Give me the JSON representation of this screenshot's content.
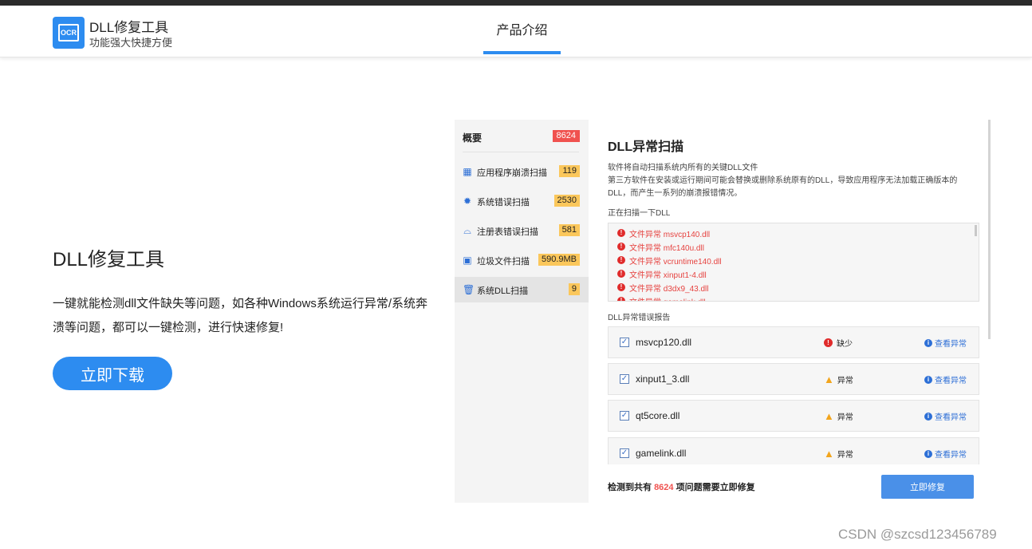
{
  "header": {
    "logo_text": "OCR",
    "brand_title": "DLL修复工具",
    "brand_subtitle": "功能强大快捷方便",
    "nav_tab": "产品介绍"
  },
  "hero": {
    "title": "DLL修复工具",
    "description": "一键就能检测dll文件缺失等问题，如各种Windows系统运行异常/系统奔溃等问题，都可以一键检测，进行快速修复!",
    "download_label": "立即下载"
  },
  "app": {
    "sidebar": {
      "overview_label": "概要",
      "overview_count": "8624",
      "items": [
        {
          "icon": "grid-icon",
          "label": "应用程序崩溃扫描",
          "count": "119"
        },
        {
          "icon": "gear-icon",
          "label": "系统错误扫描",
          "count": "2530"
        },
        {
          "icon": "registry-icon",
          "label": "注册表错误扫描",
          "count": "581"
        },
        {
          "icon": "junk-icon",
          "label": "垃圾文件扫描",
          "count": "590.9MB"
        },
        {
          "icon": "trash-icon",
          "label": "系统DLL扫描",
          "count": "9"
        }
      ]
    },
    "main": {
      "title": "DLL异常扫描",
      "desc1": "软件将自动扫描系统内所有的关键DLL文件",
      "desc2": "第三方软件在安装或运行期间可能会替换或删除系统原有的DLL，导致应用程序无法加载正确版本的DLL，而产生一系列的崩溃报错情况。",
      "scanning_label": "正在扫描一下DLL",
      "scan_lines": [
        "文件异常 msvcp140.dll",
        "文件异常 mfc140u.dll",
        "文件异常 vcruntime140.dll",
        "文件异常 xinput1-4.dll",
        "文件异常 d3dx9_43.dll",
        "文件异常 gamelink.dll"
      ],
      "report_label": "DLL异常错误报告",
      "report_rows": [
        {
          "file": "msvcp120.dll",
          "status": "缺少",
          "status_icon": "error-icon",
          "action": "查看异常"
        },
        {
          "file": "xinput1_3.dll",
          "status": "异常",
          "status_icon": "warning-icon",
          "action": "查看异常"
        },
        {
          "file": "qt5core.dll",
          "status": "异常",
          "status_icon": "warning-icon",
          "action": "查看异常"
        },
        {
          "file": "gamelink.dll",
          "status": "异常",
          "status_icon": "warning-icon",
          "action": "查看异常"
        }
      ],
      "footer_prefix": "检测到共有",
      "footer_count": "8624",
      "footer_suffix": "项问题需要立即修复",
      "fix_label": "立即修复"
    }
  },
  "watermark": "CSDN @szcsd123456789",
  "colors": {
    "accent": "#2d8cf0",
    "badge_red": "#f0524f",
    "badge_yellow": "#fbc75b",
    "error_text": "#e64340"
  }
}
